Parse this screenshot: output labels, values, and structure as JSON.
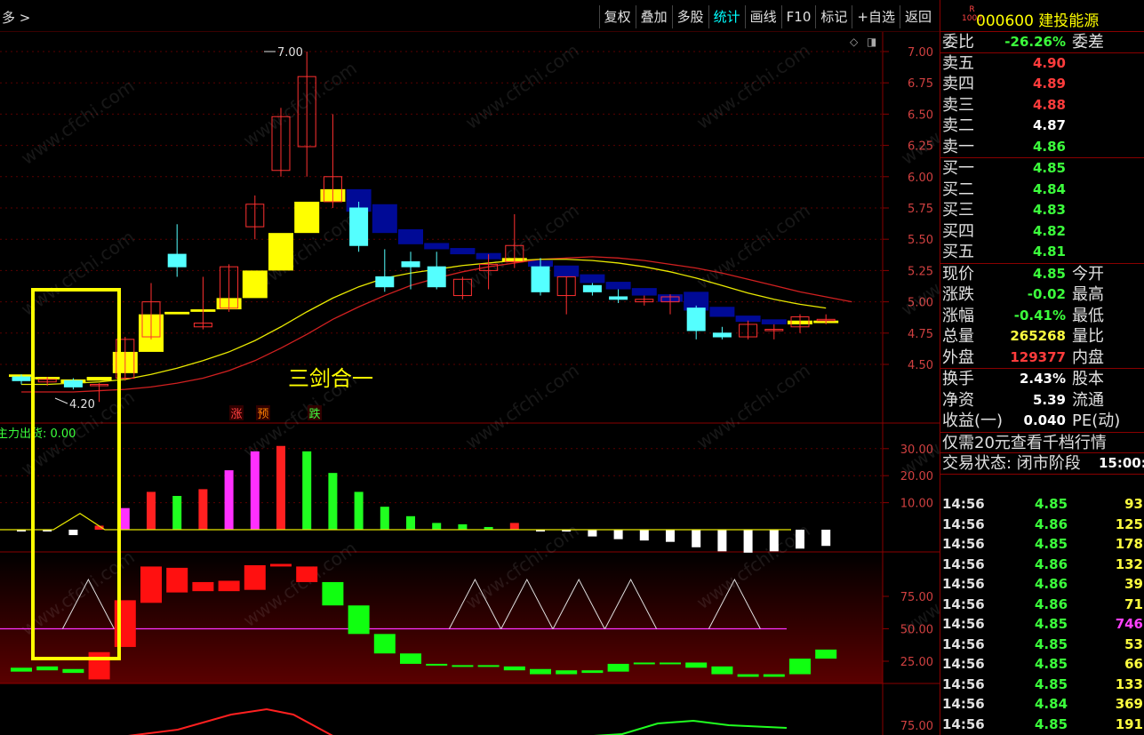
{
  "toolbar": {
    "breadcrumb": "多 >",
    "buttons": [
      "复权",
      "叠加",
      "多股",
      "统计",
      "画线",
      "F10",
      "标记",
      "+自选",
      "返回"
    ],
    "active": "统计"
  },
  "stock": {
    "code_name": "000600 建投能源",
    "badge_top": "R",
    "badge_bottom": "1000"
  },
  "quote": {
    "weibi": {
      "label": "委比",
      "value": "-26.26%",
      "label2": "委差"
    },
    "sell": [
      {
        "label": "卖五",
        "price": "4.90"
      },
      {
        "label": "卖四",
        "price": "4.89"
      },
      {
        "label": "卖三",
        "price": "4.88"
      },
      {
        "label": "卖二",
        "price": "4.87"
      },
      {
        "label": "卖一",
        "price": "4.86"
      }
    ],
    "buy": [
      {
        "label": "买一",
        "price": "4.85"
      },
      {
        "label": "买二",
        "price": "4.84"
      },
      {
        "label": "买三",
        "price": "4.83"
      },
      {
        "label": "买四",
        "price": "4.82"
      },
      {
        "label": "买五",
        "price": "4.81"
      }
    ],
    "stats": [
      {
        "label": "现价",
        "value": "4.85",
        "label2": "今开"
      },
      {
        "label": "涨跌",
        "value": "-0.02",
        "label2": "最高"
      },
      {
        "label": "涨幅",
        "value": "-0.41%",
        "label2": "最低"
      },
      {
        "label": "总量",
        "value": "265268",
        "label2": "量比"
      },
      {
        "label": "外盘",
        "value": "129377",
        "label2": "内盘"
      }
    ],
    "stats2": [
      {
        "label": "换手",
        "value": "2.43%",
        "label2": "股本"
      },
      {
        "label": "净资",
        "value": "5.39",
        "label2": "流通"
      },
      {
        "label": "收益(一)",
        "value": "0.040",
        "label2": "PE(动)"
      }
    ],
    "promo": "仅需20元查看千档行情",
    "status_label": "交易状态: 闭市阶段",
    "status_time": "15:00:0"
  },
  "ticks": [
    {
      "time": "14:56",
      "price": "4.85",
      "vol": "93"
    },
    {
      "time": "14:56",
      "price": "4.86",
      "vol": "125"
    },
    {
      "time": "14:56",
      "price": "4.85",
      "vol": "178"
    },
    {
      "time": "14:56",
      "price": "4.86",
      "vol": "132"
    },
    {
      "time": "14:56",
      "price": "4.86",
      "vol": "39"
    },
    {
      "time": "14:56",
      "price": "4.86",
      "vol": "71"
    },
    {
      "time": "14:56",
      "price": "4.85",
      "vol": "746"
    },
    {
      "time": "14:56",
      "price": "4.85",
      "vol": "53"
    },
    {
      "time": "14:56",
      "price": "4.85",
      "vol": "66"
    },
    {
      "time": "14:56",
      "price": "4.85",
      "vol": "133"
    },
    {
      "time": "14:56",
      "price": "4.84",
      "vol": "369"
    },
    {
      "time": "14:56",
      "price": "4.85",
      "vol": "191"
    }
  ],
  "chart_data": {
    "type": "candlestick",
    "price_axis": [
      "7.00",
      "6.75",
      "6.50",
      "6.25",
      "6.00",
      "5.75",
      "5.50",
      "5.25",
      "5.00",
      "4.75",
      "4.50"
    ],
    "high_label": "7.00",
    "low_label": "4.20",
    "annotation": "三剑合一",
    "signals": [
      "涨",
      "预",
      "跌"
    ],
    "indicator1_label": "主力出货: 0.00",
    "indicator1_axis": [
      "30.00",
      "20.00",
      "10.00"
    ],
    "indicator2_axis": [
      "75.00",
      "50.00",
      "25.00"
    ],
    "indicator3_axis": [
      "75.00"
    ],
    "watermark": "www.cfchi.com",
    "candles": [
      {
        "o": 4.4,
        "h": 4.42,
        "l": 4.34,
        "c": 4.37
      },
      {
        "o": 4.36,
        "h": 4.4,
        "l": 4.33,
        "c": 4.38
      },
      {
        "o": 4.37,
        "h": 4.39,
        "l": 4.3,
        "c": 4.32
      },
      {
        "o": 4.33,
        "h": 4.35,
        "l": 4.2,
        "c": 4.34
      },
      {
        "o": 4.39,
        "h": 4.72,
        "l": 4.37,
        "c": 4.7
      },
      {
        "o": 4.72,
        "h": 5.15,
        "l": 4.7,
        "c": 5.0
      },
      {
        "o": 5.38,
        "h": 5.62,
        "l": 5.2,
        "c": 5.28
      },
      {
        "o": 4.8,
        "h": 5.2,
        "l": 4.78,
        "c": 4.83
      },
      {
        "o": 4.95,
        "h": 5.3,
        "l": 4.92,
        "c": 5.28
      },
      {
        "o": 5.6,
        "h": 5.85,
        "l": 5.5,
        "c": 5.78
      },
      {
        "o": 6.05,
        "h": 6.55,
        "l": 6.0,
        "c": 6.48
      },
      {
        "o": 6.24,
        "h": 7.0,
        "l": 6.0,
        "c": 6.8
      },
      {
        "o": 5.8,
        "h": 6.5,
        "l": 5.75,
        "c": 6.0
      },
      {
        "o": 5.75,
        "h": 5.8,
        "l": 5.4,
        "c": 5.45
      },
      {
        "o": 5.2,
        "h": 5.42,
        "l": 5.08,
        "c": 5.12
      },
      {
        "o": 5.32,
        "h": 5.4,
        "l": 5.1,
        "c": 5.28
      },
      {
        "o": 5.28,
        "h": 5.4,
        "l": 5.1,
        "c": 5.12
      },
      {
        "o": 5.05,
        "h": 5.2,
        "l": 5.02,
        "c": 5.18
      },
      {
        "o": 5.25,
        "h": 5.38,
        "l": 5.1,
        "c": 5.3
      },
      {
        "o": 5.32,
        "h": 5.7,
        "l": 5.27,
        "c": 5.45
      },
      {
        "o": 5.28,
        "h": 5.35,
        "l": 5.05,
        "c": 5.08
      },
      {
        "o": 5.05,
        "h": 5.2,
        "l": 4.9,
        "c": 5.2
      },
      {
        "o": 5.13,
        "h": 5.15,
        "l": 5.05,
        "c": 5.08
      },
      {
        "o": 5.04,
        "h": 5.1,
        "l": 4.99,
        "c": 5.02
      },
      {
        "o": 5.0,
        "h": 5.05,
        "l": 4.97,
        "c": 5.02
      },
      {
        "o": 5.0,
        "h": 5.06,
        "l": 4.9,
        "c": 5.04
      },
      {
        "o": 4.95,
        "h": 4.97,
        "l": 4.7,
        "c": 4.77
      },
      {
        "o": 4.75,
        "h": 4.8,
        "l": 4.7,
        "c": 4.72
      },
      {
        "o": 4.72,
        "h": 4.85,
        "l": 4.7,
        "c": 4.82
      },
      {
        "o": 4.77,
        "h": 4.82,
        "l": 4.7,
        "c": 4.78
      },
      {
        "o": 4.8,
        "h": 4.9,
        "l": 4.75,
        "c": 4.88
      },
      {
        "o": 4.85,
        "h": 4.9,
        "l": 4.82,
        "c": 4.86
      }
    ],
    "brick_series": [
      {
        "lo": 4.4,
        "hi": 4.42,
        "color": "yellow"
      },
      {
        "lo": 4.38,
        "hi": 4.4,
        "color": "yellow"
      },
      {
        "lo": 4.35,
        "hi": 4.38,
        "color": "yellow"
      },
      {
        "lo": 4.37,
        "hi": 4.4,
        "color": "yellow"
      },
      {
        "lo": 4.43,
        "hi": 4.6,
        "color": "yellow"
      },
      {
        "lo": 4.6,
        "hi": 4.9,
        "color": "yellow"
      },
      {
        "lo": 4.9,
        "hi": 4.92,
        "color": "yellow"
      },
      {
        "lo": 4.92,
        "hi": 4.94,
        "color": "yellow"
      },
      {
        "lo": 4.94,
        "hi": 5.03,
        "color": "yellow"
      },
      {
        "lo": 5.03,
        "hi": 5.25,
        "color": "yellow"
      },
      {
        "lo": 5.25,
        "hi": 5.55,
        "color": "yellow"
      },
      {
        "lo": 5.55,
        "hi": 5.8,
        "color": "yellow"
      },
      {
        "lo": 5.8,
        "hi": 5.9,
        "color": "yellow"
      },
      {
        "lo": 5.72,
        "hi": 5.9,
        "color": "navy"
      },
      {
        "lo": 5.55,
        "hi": 5.78,
        "color": "navy"
      },
      {
        "lo": 5.46,
        "hi": 5.58,
        "color": "navy"
      },
      {
        "lo": 5.42,
        "hi": 5.47,
        "color": "navy"
      },
      {
        "lo": 5.38,
        "hi": 5.43,
        "color": "navy"
      },
      {
        "lo": 5.34,
        "hi": 5.39,
        "color": "navy"
      },
      {
        "lo": 5.32,
        "hi": 5.35,
        "color": "yellow"
      },
      {
        "lo": 5.28,
        "hi": 5.33,
        "color": "navy"
      },
      {
        "lo": 5.2,
        "hi": 5.29,
        "color": "navy"
      },
      {
        "lo": 5.15,
        "hi": 5.22,
        "color": "navy"
      },
      {
        "lo": 5.1,
        "hi": 5.16,
        "color": "navy"
      },
      {
        "lo": 5.05,
        "hi": 5.11,
        "color": "navy"
      },
      {
        "lo": 5.0,
        "hi": 5.06,
        "color": "navy"
      },
      {
        "lo": 4.93,
        "hi": 5.08,
        "color": "navy"
      },
      {
        "lo": 4.88,
        "hi": 4.96,
        "color": "navy"
      },
      {
        "lo": 4.84,
        "hi": 4.89,
        "color": "navy"
      },
      {
        "lo": 4.82,
        "hi": 4.86,
        "color": "navy"
      },
      {
        "lo": 4.82,
        "hi": 4.85,
        "color": "yellow"
      },
      {
        "lo": 4.83,
        "hi": 4.85,
        "color": "yellow"
      }
    ],
    "ma_yellow": [
      4.34,
      4.34,
      4.35,
      4.36,
      4.38,
      4.42,
      4.47,
      4.53,
      4.6,
      4.69,
      4.8,
      4.92,
      5.03,
      5.12,
      5.19,
      5.23,
      5.26,
      5.29,
      5.31,
      5.33,
      5.34,
      5.34,
      5.33,
      5.31,
      5.28,
      5.24,
      5.19,
      5.13,
      5.07,
      5.02,
      4.98,
      4.95
    ],
    "ma_red": [
      4.28,
      4.28,
      4.28,
      4.29,
      4.3,
      4.32,
      4.35,
      4.39,
      4.45,
      4.53,
      4.63,
      4.74,
      4.86,
      4.96,
      5.05,
      5.13,
      5.19,
      5.24,
      5.28,
      5.31,
      5.34,
      5.35,
      5.36,
      5.35,
      5.33,
      5.3,
      5.27,
      5.23,
      5.18,
      5.13,
      5.08,
      5.04
    ],
    "bars1": [
      {
        "v": -0.5,
        "c": "w"
      },
      {
        "v": -0.5,
        "c": "w"
      },
      {
        "v": -2,
        "c": "w"
      },
      {
        "v": 1.5,
        "c": "r"
      },
      {
        "v": 8,
        "c": "m"
      },
      {
        "v": 14,
        "c": "r"
      },
      {
        "v": 12.5,
        "c": "g"
      },
      {
        "v": 15,
        "c": "r"
      },
      {
        "v": 22,
        "c": "m"
      },
      {
        "v": 29,
        "c": "m"
      },
      {
        "v": 31,
        "c": "r"
      },
      {
        "v": 29,
        "c": "g"
      },
      {
        "v": 21,
        "c": "g"
      },
      {
        "v": 14,
        "c": "g"
      },
      {
        "v": 8.5,
        "c": "g"
      },
      {
        "v": 5,
        "c": "g"
      },
      {
        "v": 2.5,
        "c": "g"
      },
      {
        "v": 2,
        "c": "g"
      },
      {
        "v": 1,
        "c": "g"
      },
      {
        "v": 2.5,
        "c": "r"
      },
      {
        "v": -0.3,
        "c": "w"
      },
      {
        "v": -0.5,
        "c": "w"
      },
      {
        "v": -2.5,
        "c": "w"
      },
      {
        "v": -3.5,
        "c": "w"
      },
      {
        "v": -4,
        "c": "w"
      },
      {
        "v": -4.5,
        "c": "w"
      },
      {
        "v": -6.5,
        "c": "w"
      },
      {
        "v": -8,
        "c": "w"
      },
      {
        "v": -8.5,
        "c": "w"
      },
      {
        "v": -8,
        "c": "w"
      },
      {
        "v": -7,
        "c": "w"
      },
      {
        "v": -6,
        "c": "w"
      }
    ],
    "line1": [
      0,
      0,
      0,
      0,
      0,
      0,
      0,
      0,
      0,
      0,
      0,
      0,
      0,
      0,
      0,
      0,
      0,
      0,
      0,
      0,
      0,
      0,
      0,
      0,
      0,
      0,
      0,
      0,
      0,
      0,
      0,
      0
    ],
    "bars2": [
      {
        "o": 17,
        "c": 20,
        "col": "g"
      },
      {
        "o": 18,
        "c": 21,
        "col": "g"
      },
      {
        "o": 16,
        "c": 19,
        "col": "g"
      },
      {
        "o": 11,
        "c": 32,
        "col": "r"
      },
      {
        "o": 36,
        "c": 72,
        "col": "r"
      },
      {
        "o": 70,
        "c": 98,
        "col": "r"
      },
      {
        "o": 78,
        "c": 97,
        "col": "r"
      },
      {
        "o": 79,
        "c": 86,
        "col": "r"
      },
      {
        "o": 79,
        "c": 87,
        "col": "r"
      },
      {
        "o": 80,
        "c": 99,
        "col": "r"
      },
      {
        "o": 98,
        "c": 100,
        "col": "r"
      },
      {
        "o": 86,
        "c": 98,
        "col": "r"
      },
      {
        "o": 86,
        "c": 68,
        "col": "g"
      },
      {
        "o": 68,
        "c": 46,
        "col": "g"
      },
      {
        "o": 46,
        "c": 31,
        "col": "g"
      },
      {
        "o": 31,
        "c": 23,
        "col": "g"
      },
      {
        "o": 22,
        "c": 23,
        "col": "g"
      },
      {
        "o": 21,
        "c": 22,
        "col": "g"
      },
      {
        "o": 21,
        "c": 22,
        "col": "g"
      },
      {
        "o": 18,
        "c": 21,
        "col": "g"
      },
      {
        "o": 15,
        "c": 19,
        "col": "g"
      },
      {
        "o": 15,
        "c": 18,
        "col": "g"
      },
      {
        "o": 16,
        "c": 18,
        "col": "g"
      },
      {
        "o": 17,
        "c": 23,
        "col": "g"
      },
      {
        "o": 23,
        "c": 24,
        "col": "g"
      },
      {
        "o": 23,
        "c": 24,
        "col": "g"
      },
      {
        "o": 20,
        "c": 24,
        "col": "g"
      },
      {
        "o": 15,
        "c": 21,
        "col": "g"
      },
      {
        "o": 13,
        "c": 15,
        "col": "g"
      },
      {
        "o": 13,
        "c": 15,
        "col": "g"
      },
      {
        "o": 15,
        "c": 27,
        "col": "g"
      },
      {
        "o": 27,
        "c": 34,
        "col": "g"
      }
    ],
    "triangles_at": [
      2,
      17,
      19,
      21,
      23,
      27
    ]
  }
}
